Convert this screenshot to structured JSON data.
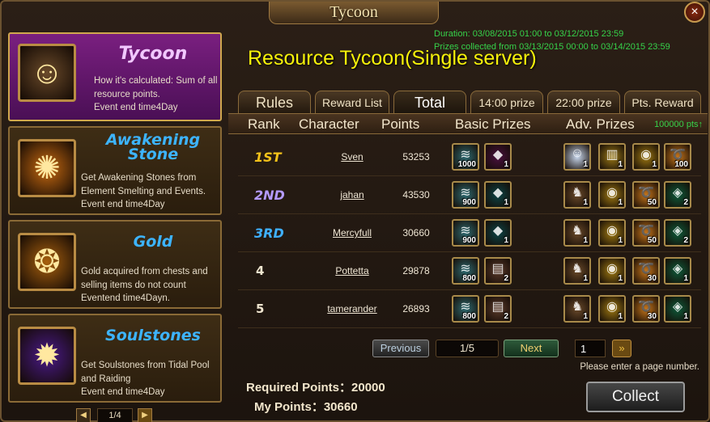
{
  "window": {
    "title": "Tycoon",
    "close_glyph": "×"
  },
  "sidebar": {
    "items": [
      {
        "title": "Tycoon",
        "desc": "How it's calculated: Sum of all resource points.",
        "end": "Event end time4Day",
        "icon": "tycoon-portrait-icon",
        "active": true,
        "title_color": "#f1c8ff"
      },
      {
        "title": "Awakening Stone",
        "desc": "Get Awakening Stones from Element Smelting and Events.",
        "end": "Event end time4Day",
        "icon": "awakening-stone-icon",
        "active": false,
        "title_color": "#3db4ff"
      },
      {
        "title": "Gold",
        "desc": "Gold acquired from chests and selling items do not count",
        "end": "Eventend time4Dayn.",
        "icon": "gold-coin-icon",
        "active": false,
        "title_color": "#3db4ff"
      },
      {
        "title": "Soulstones",
        "desc": "Get Soulstones from Tidal Pool and Raiding",
        "end": "Event end time4Day",
        "icon": "soulstone-orb-icon",
        "active": false,
        "title_color": "#3db4ff"
      }
    ],
    "pager": {
      "label": "1/4",
      "prev": "◀",
      "next": "▶"
    }
  },
  "main": {
    "duration_line": "Duration: 03/08/2015 01:00 to 03/12/2015 23:59",
    "prizes_line": "Prizes collected from 03/13/2015 00:00 to 03/14/2015 23:59",
    "title": "Resource Tycoon(Single server)",
    "tabs": [
      {
        "label": "Rules",
        "active": false
      },
      {
        "label": "Reward List",
        "active": false
      },
      {
        "label": "Total",
        "active": true
      },
      {
        "label": "14:00 prize",
        "active": false
      },
      {
        "label": "22:00 prize",
        "active": false
      },
      {
        "label": "Pts. Reward",
        "active": false
      }
    ],
    "headers": {
      "rank": "Rank",
      "character": "Character",
      "points": "Points",
      "basic": "Basic Prizes",
      "adv": "Adv. Prizes",
      "pts_note": "100000 pts↑"
    },
    "rows": [
      {
        "rank": "1ST",
        "rank_color": "#f3c21a",
        "character": "Sven",
        "points": "53253",
        "basic": [
          {
            "name": "resource-scroll-icon",
            "qty": "1000",
            "color": "#2e6a70"
          },
          {
            "name": "purple-gem-icon",
            "qty": "1",
            "color": "#4a1040"
          }
        ],
        "adv": [
          {
            "name": "hero-portrait-icon",
            "qty": "1",
            "color": "#c9d8ee"
          },
          {
            "name": "gold-scroll-icon",
            "qty": "1",
            "color": "#9c7a16"
          },
          {
            "name": "gold-coins-icon",
            "qty": "1",
            "color": "#a07a12"
          },
          {
            "name": "gold-swirl-icon",
            "qty": "100",
            "color": "#c8761a"
          }
        ]
      },
      {
        "rank": "2ND",
        "rank_color": "#b49bff",
        "character": "jahan",
        "points": "43530",
        "basic": [
          {
            "name": "resource-scroll-icon",
            "qty": "900",
            "color": "#2e6a70"
          },
          {
            "name": "teal-gem-icon",
            "qty": "1",
            "color": "#0c4446"
          }
        ],
        "adv": [
          {
            "name": "white-dragon-icon",
            "qty": "1",
            "color": "#6a4a2a"
          },
          {
            "name": "gold-coins-icon",
            "qty": "1",
            "color": "#a07a12"
          },
          {
            "name": "gold-swirl-icon",
            "qty": "50",
            "color": "#c8761a"
          },
          {
            "name": "green-crystal-icon",
            "qty": "2",
            "color": "#0e5a3a"
          }
        ]
      },
      {
        "rank": "3RD",
        "rank_color": "#3fb0ff",
        "character": "Mercyfull",
        "points": "30660",
        "basic": [
          {
            "name": "resource-scroll-icon",
            "qty": "900",
            "color": "#2e6a70"
          },
          {
            "name": "teal-gem-icon",
            "qty": "1",
            "color": "#0c4446"
          }
        ],
        "adv": [
          {
            "name": "white-dragon-icon",
            "qty": "1",
            "color": "#6a4a2a"
          },
          {
            "name": "gold-coins-icon",
            "qty": "1",
            "color": "#a07a12"
          },
          {
            "name": "gold-swirl-icon",
            "qty": "50",
            "color": "#c8761a"
          },
          {
            "name": "green-crystal-icon",
            "qty": "2",
            "color": "#0e5a3a"
          }
        ]
      },
      {
        "rank": "4",
        "rank_color": "#f0e6d0",
        "character": "Pottetta",
        "points": "29878",
        "basic": [
          {
            "name": "resource-scroll-icon",
            "qty": "800",
            "color": "#2e6a70"
          },
          {
            "name": "treasure-chest-icon",
            "qty": "2",
            "color": "#5a3a2a"
          }
        ],
        "adv": [
          {
            "name": "white-dragon-icon",
            "qty": "1",
            "color": "#6a4a2a"
          },
          {
            "name": "gold-coins-icon",
            "qty": "1",
            "color": "#a07a12"
          },
          {
            "name": "gold-swirl-icon",
            "qty": "30",
            "color": "#c8761a"
          },
          {
            "name": "green-crystal-icon",
            "qty": "1",
            "color": "#0e5a3a"
          }
        ]
      },
      {
        "rank": "5",
        "rank_color": "#f0e6d0",
        "character": "tamerander",
        "points": "26893",
        "basic": [
          {
            "name": "resource-scroll-icon",
            "qty": "800",
            "color": "#2e6a70"
          },
          {
            "name": "treasure-chest-icon",
            "qty": "2",
            "color": "#5a3a2a"
          }
        ],
        "adv": [
          {
            "name": "white-dragon-icon",
            "qty": "1",
            "color": "#6a4a2a"
          },
          {
            "name": "gold-coins-icon",
            "qty": "1",
            "color": "#a07a12"
          },
          {
            "name": "gold-swirl-icon",
            "qty": "30",
            "color": "#c8761a"
          },
          {
            "name": "green-crystal-icon",
            "qty": "1",
            "color": "#0e5a3a"
          }
        ]
      }
    ],
    "pager": {
      "prev": "Previous",
      "page": "1/5",
      "next": "Next",
      "input_value": "1",
      "go": "»",
      "hint": "Please enter a page number."
    },
    "required_points": "Required Points：20000",
    "my_points": "My Points：30660",
    "collect": "Collect"
  }
}
